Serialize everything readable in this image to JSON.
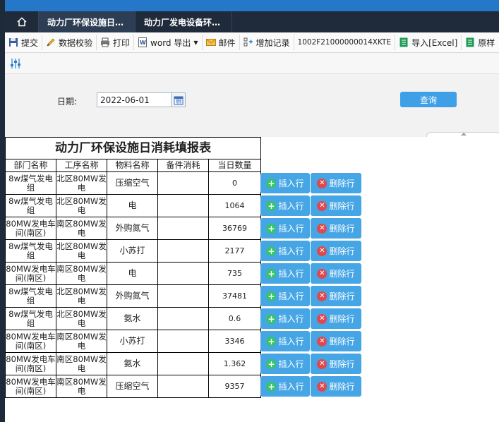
{
  "tabs": [
    {
      "label": "动力厂环保设施日…",
      "active": true
    },
    {
      "label": "动力厂发电设备环…",
      "active": false
    }
  ],
  "toolbar": {
    "submit": "提交",
    "validate": "数据校验",
    "print": "打印",
    "word_export": "word 导出",
    "mail": "邮件",
    "add_record": "增加记录",
    "record_code": "1002F21000000014XKTE",
    "import_excel": "导入[Excel]",
    "raw_sample": "原样"
  },
  "query": {
    "date_label": "日期:",
    "date_value": "2022-06-01",
    "query_button": "查询"
  },
  "report": {
    "title": "动力厂环保设施日消耗填报表",
    "headers": [
      "部门名称",
      "工序名称",
      "物料名称",
      "备件消耗",
      "当日数量"
    ],
    "rows": [
      {
        "dept": "8w煤气发电组",
        "proc": "北区80MW发电",
        "material": "压缩空气",
        "spare": "",
        "qty": "0"
      },
      {
        "dept": "8w煤气发电组",
        "proc": "北区80MW发电",
        "material": "电",
        "spare": "",
        "qty": "1064"
      },
      {
        "dept": "80MW发电车间(南区)",
        "proc": "南区80MW发电",
        "material": "外购氮气",
        "spare": "",
        "qty": "36769"
      },
      {
        "dept": "8w煤气发电组",
        "proc": "北区80MW发电",
        "material": "小苏打",
        "spare": "",
        "qty": "2177"
      },
      {
        "dept": "80MW发电车间(南区)",
        "proc": "南区80MW发电",
        "material": "电",
        "spare": "",
        "qty": "735"
      },
      {
        "dept": "8w煤气发电组",
        "proc": "北区80MW发电",
        "material": "外购氮气",
        "spare": "",
        "qty": "37481"
      },
      {
        "dept": "8w煤气发电组",
        "proc": "北区80MW发电",
        "material": "氨水",
        "spare": "",
        "qty": "0.6"
      },
      {
        "dept": "80MW发电车间(南区)",
        "proc": "南区80MW发电",
        "material": "小苏打",
        "spare": "",
        "qty": "3346"
      },
      {
        "dept": "80MW发电车间(南区)",
        "proc": "南区80MW发电",
        "material": "氨水",
        "spare": "",
        "qty": "1.362"
      },
      {
        "dept": "80MW发电车间(南区)",
        "proc": "南区80MW发电",
        "material": "压缩空气",
        "spare": "",
        "qty": "9357"
      }
    ],
    "insert_label": "插入行",
    "delete_label": "删除行"
  },
  "colors": {
    "tab_bar": "#1f2b3b",
    "top_strip": "#2477c9",
    "button_blue": "#45a5e5",
    "insert_icon": "#34c46b",
    "delete_icon": "#e0484d"
  }
}
